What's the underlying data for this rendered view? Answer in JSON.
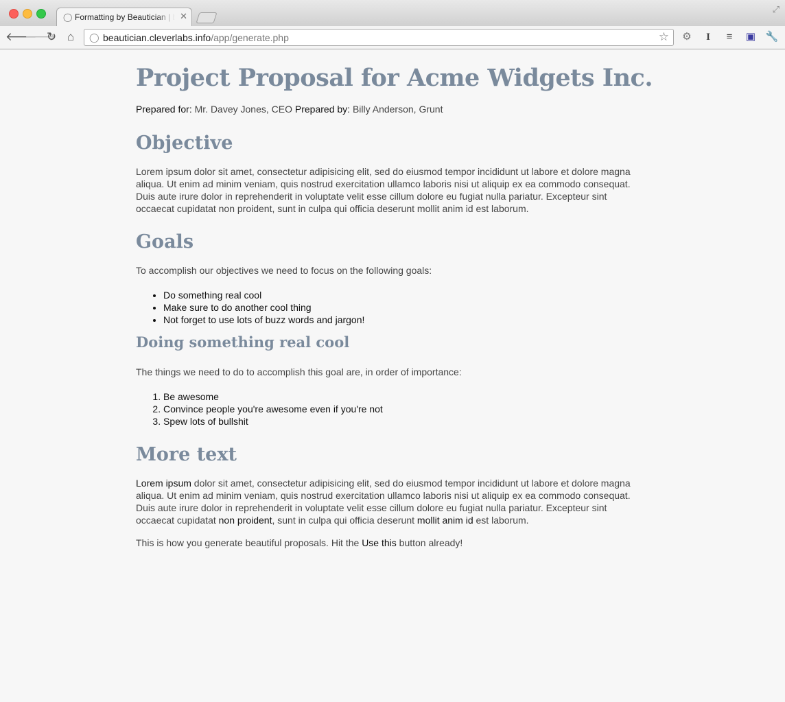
{
  "browser": {
    "tab_title": "Formatting by Beautician | beautician",
    "url_host": "beautician.cleverlabs.info",
    "url_path": "/app/generate.php"
  },
  "document": {
    "title": "Project Proposal for Acme Widgets Inc.",
    "prepared_for_label": "Prepared for:",
    "prepared_for_value": " Mr. Davey Jones, CEO ",
    "prepared_by_label": "Prepared by:",
    "prepared_by_value": " Billy Anderson, Grunt",
    "objective": {
      "heading": "Objective",
      "text": "Lorem ipsum dolor sit amet, consectetur adipisicing elit, sed do eiusmod tempor incididunt ut labore et dolore magna aliqua. Ut enim ad minim veniam, quis nostrud exercitation ullamco laboris nisi ut aliquip ex ea commodo consequat. Duis aute irure dolor in reprehenderit in voluptate velit esse cillum dolore eu fugiat nulla pariatur. Excepteur sint occaecat cupidatat non proident, sunt in culpa qui officia deserunt mollit anim id est laborum."
    },
    "goals": {
      "heading": "Goals",
      "intro": "To accomplish our objectives we need to focus on the following goals:",
      "items": [
        "Do something real cool",
        "Make sure to do another cool thing",
        "Not forget to use lots of buzz words and jargon!"
      ]
    },
    "cool": {
      "heading": "Doing something real cool",
      "intro": "The things we need to do to accomplish this goal are, in order of importance:",
      "items": [
        "Be awesome",
        "Convince people you're awesome even if you're not",
        "Spew lots of bullshit"
      ]
    },
    "more": {
      "heading": "More text",
      "lead": "Lorem ipsum",
      "text1": " dolor sit amet, consectetur adipisicing elit, sed do eiusmod tempor incididunt ut labore et dolore magna aliqua. Ut enim ad minim veniam, quis nostrud exercitation ullamco laboris nisi ut aliquip ex ea commodo consequat. Duis aute irure dolor in reprehenderit in voluptate velit esse cillum dolore eu fugiat nulla pariatur. Excepteur sint occaecat cupidatat ",
      "strong1": "non proident",
      "text2": ", sunt in culpa qui officia deserunt ",
      "strong2": "mollit anim id",
      "text3": " est laborum.",
      "closing_pre": "This is how you generate beautiful proposals. Hit the ",
      "closing_strong": "Use this",
      "closing_post": " button already!"
    }
  }
}
